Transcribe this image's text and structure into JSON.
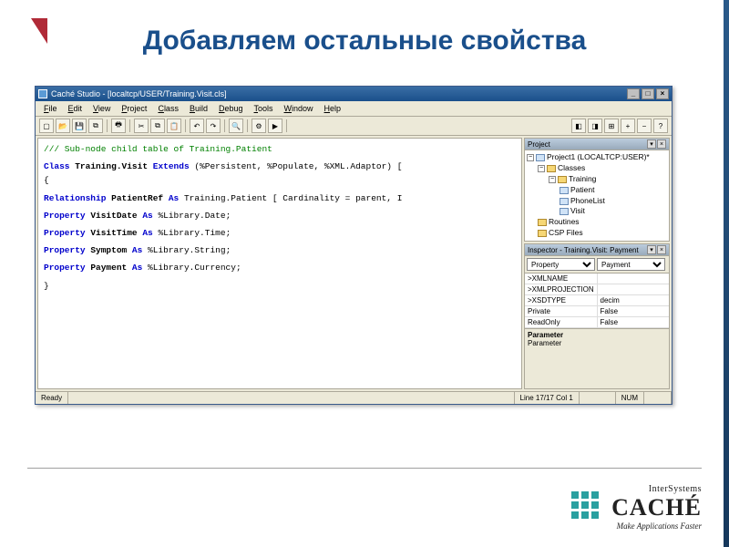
{
  "slide": {
    "title": "Добавляем остальные свойства"
  },
  "window": {
    "title": "Caché Studio - [localtcp/USER/Training.Visit.cls]",
    "menus": [
      "File",
      "Edit",
      "View",
      "Project",
      "Class",
      "Build",
      "Debug",
      "Tools",
      "Window",
      "Help"
    ]
  },
  "code": {
    "l1": "/// Sub-node child table of Training.Patient",
    "l2a": "Class ",
    "l2b": "Training.Visit",
    "l2c": " Extends ",
    "l2d": "(%Persistent, %Populate, %XML.Adaptor) [",
    "l3": "{",
    "l4a": "Relationship ",
    "l4b": "PatientRef",
    "l4c": " As ",
    "l4d": "Training.Patient",
    "l4e": " [ Cardinality = parent, I",
    "l5a": "Property ",
    "l5b": "VisitDate",
    "l5c": " As ",
    "l5d": "%Library.Date",
    "l5e": ";",
    "l6a": "Property ",
    "l6b": "VisitTime",
    "l6c": " As ",
    "l6d": "%Library.Time",
    "l6e": ";",
    "l7a": "Property ",
    "l7b": "Symptom",
    "l7c": " As ",
    "l7d": "%Library.String",
    "l7e": ";",
    "l8a": "Property ",
    "l8b": "Payment",
    "l8c": " As ",
    "l8d": "%Library.Currency",
    "l8e": ";",
    "l9": "}"
  },
  "project_panel": {
    "title": "Project",
    "root": "Project1 (LOCALTCP:USER)*",
    "classes": "Classes",
    "training": "Training",
    "items": [
      "Patient",
      "PhoneList",
      "Visit"
    ],
    "routines": "Routines",
    "csp": "CSP Files"
  },
  "inspector": {
    "title": "Inspector - Training.Visit: Payment",
    "dropdown1": "Property",
    "dropdown2": "Payment",
    "rows": [
      {
        "k": ">XMLNAME",
        "v": ""
      },
      {
        "k": ">XMLPROJECTION",
        "v": ""
      },
      {
        "k": ">XSDTYPE",
        "v": "decim"
      },
      {
        "k": "Private",
        "v": "False"
      },
      {
        "k": "ReadOnly",
        "v": "False"
      }
    ],
    "footer_label": "Parameter",
    "footer_sub": "Parameter"
  },
  "status": {
    "ready": "Ready",
    "pos": "Line 17/17 Col 1",
    "num": "NUM"
  },
  "logo": {
    "inter": "InterSystems",
    "cache": "CACHÉ",
    "tag": "Make Applications Faster"
  }
}
